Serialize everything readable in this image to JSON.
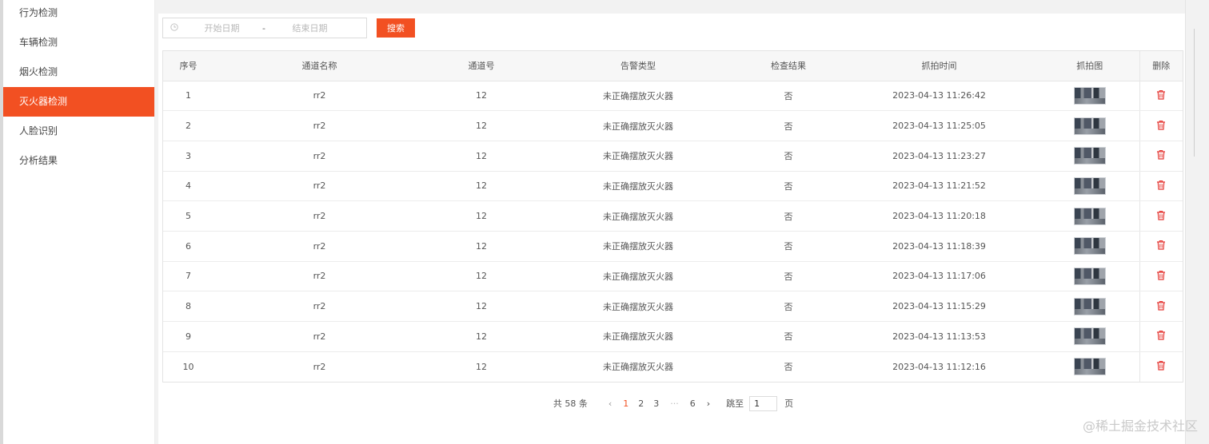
{
  "sidebar": {
    "items": [
      {
        "label": "行为检测"
      },
      {
        "label": "车辆检测"
      },
      {
        "label": "烟火检测"
      },
      {
        "label": "灭火器检测"
      },
      {
        "label": "人脸识别"
      },
      {
        "label": "分析结果"
      }
    ],
    "active_index": 3
  },
  "search": {
    "start_placeholder": "开始日期",
    "separator": "-",
    "end_placeholder": "结束日期",
    "button_label": "搜索",
    "clock_icon": "clock-icon"
  },
  "table": {
    "headers": [
      "序号",
      "通道名称",
      "通道号",
      "告警类型",
      "检查结果",
      "抓拍时间",
      "抓拍图",
      "删除"
    ],
    "rows": [
      {
        "index": "1",
        "channel_name": "rr2",
        "channel_no": "12",
        "alarm_type": "未正确摆放灭火器",
        "result": "否",
        "time": "2023-04-13 11:26:42"
      },
      {
        "index": "2",
        "channel_name": "rr2",
        "channel_no": "12",
        "alarm_type": "未正确摆放灭火器",
        "result": "否",
        "time": "2023-04-13 11:25:05"
      },
      {
        "index": "3",
        "channel_name": "rr2",
        "channel_no": "12",
        "alarm_type": "未正确摆放灭火器",
        "result": "否",
        "time": "2023-04-13 11:23:27"
      },
      {
        "index": "4",
        "channel_name": "rr2",
        "channel_no": "12",
        "alarm_type": "未正确摆放灭火器",
        "result": "否",
        "time": "2023-04-13 11:21:52"
      },
      {
        "index": "5",
        "channel_name": "rr2",
        "channel_no": "12",
        "alarm_type": "未正确摆放灭火器",
        "result": "否",
        "time": "2023-04-13 11:20:18"
      },
      {
        "index": "6",
        "channel_name": "rr2",
        "channel_no": "12",
        "alarm_type": "未正确摆放灭火器",
        "result": "否",
        "time": "2023-04-13 11:18:39"
      },
      {
        "index": "7",
        "channel_name": "rr2",
        "channel_no": "12",
        "alarm_type": "未正确摆放灭火器",
        "result": "否",
        "time": "2023-04-13 11:17:06"
      },
      {
        "index": "8",
        "channel_name": "rr2",
        "channel_no": "12",
        "alarm_type": "未正确摆放灭火器",
        "result": "否",
        "time": "2023-04-13 11:15:29"
      },
      {
        "index": "9",
        "channel_name": "rr2",
        "channel_no": "12",
        "alarm_type": "未正确摆放灭火器",
        "result": "否",
        "time": "2023-04-13 11:13:53"
      },
      {
        "index": "10",
        "channel_name": "rr2",
        "channel_no": "12",
        "alarm_type": "未正确摆放灭火器",
        "result": "否",
        "time": "2023-04-13 11:12:16"
      }
    ],
    "thumbnail_icon": "snapshot-thumbnail",
    "delete_icon": "trash-icon"
  },
  "pagination": {
    "total_text": "共 58 条",
    "prev_symbol": "‹",
    "pages": [
      "1",
      "2",
      "3"
    ],
    "ellipsis": "···",
    "last_page": "6",
    "next_symbol": "›",
    "current_page": "1",
    "goto_label": "跳至",
    "goto_value": "1",
    "page_suffix": "页"
  },
  "watermark": "@稀土掘金技术社区",
  "colors": {
    "accent": "#f25022",
    "delete_red": "#e53935"
  }
}
